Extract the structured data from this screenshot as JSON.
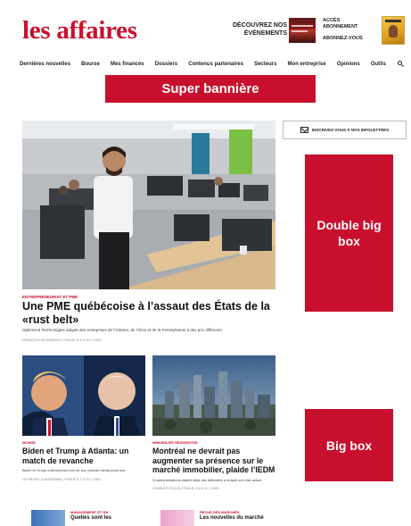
{
  "header": {
    "logo": "les affaires",
    "events_line1": "DÉCOUVREZ NOS",
    "events_line2": "ÉVÉNEMENTS",
    "access_line1": "ACCÈS",
    "access_line2": "ABONNEMENT",
    "subscribe": "ABONNEZ-VOUS"
  },
  "nav": {
    "items": [
      "Dernières nouvelles",
      "Bourse",
      "Mes finances",
      "Dossiers",
      "Contenus partenaires",
      "Secteurs",
      "Mon entreprise",
      "Opinions",
      "Outils"
    ]
  },
  "ads": {
    "super_banner": "Super bannière",
    "double_big_box": "Double big box",
    "big_box": "Big box"
  },
  "newsletter": {
    "label": "INSCRIVEZ-VOUS À NOS INFOLETTRES"
  },
  "hero": {
    "category": "ENTREPRENEURIAT ET PME",
    "title": "Une PME québécoise à l’assaut des États de la «rust belt»",
    "description": "Optimized Technologies adapte des entreprises de l’Ontario, de l’Ohio et de la Pennsylvanie à des prix différents.",
    "meta": "FRANÇOIS DESMARAIS | PUBLIÉ À 9 H 00 | 3 MIN"
  },
  "cards": [
    {
      "category": "MONDE",
      "title": "Biden et Trump à Atlanta: un match de revanche",
      "description": "Biden et Trump s’affronteront lors de leur premier débat jeudi soir.",
      "meta": "LA PRESSE CANADIENNE | PUBLIÉ À 7 H 20 | 3 MIN"
    },
    {
      "category": "IMMOBILIER RÉSIDENTIEL",
      "title": "Montréal ne devrait pas augmenter sa présence sur le marché immobilier, plaide l’IEDM",
      "description": "Si administrations étaient déjà des difficultés à remplir son rôle actuel.",
      "meta": "CHARLES POULIN | PUBLIÉ À 8 H 10 | 3 MIN"
    }
  ],
  "minis": [
    {
      "category": "MANAGEMENT ET RH",
      "title": "Quelles sont les"
    },
    {
      "category": "REVUE DES MARCHÉS",
      "title": "Les nouvelles du marché"
    }
  ]
}
